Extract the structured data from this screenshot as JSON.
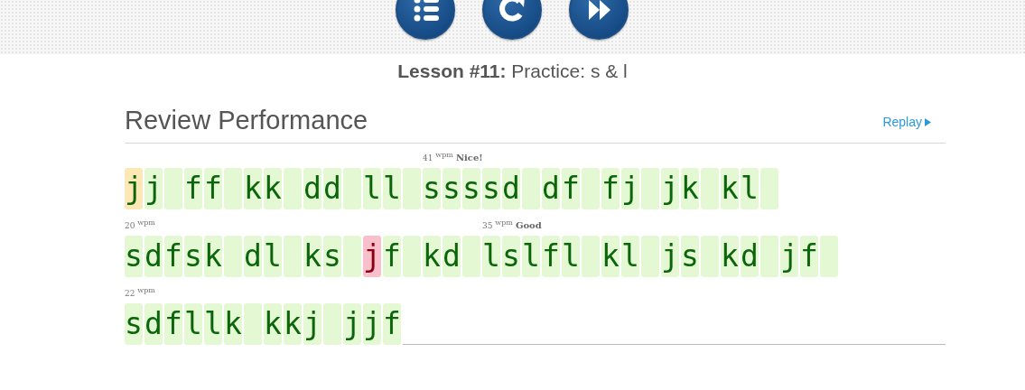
{
  "toolbar": {
    "buttons": [
      {
        "kind": "list"
      },
      {
        "kind": "repeat"
      },
      {
        "kind": "next"
      }
    ]
  },
  "lesson": "**Lesson #11:** Practice: s & l",
  "review": {
    "title": "Review Performance",
    "replay": "Replay"
  },
  "lines": [
    {
      "words": [
        {
          "chars": [
            {
              "char": "j",
              "corrected": true,
              "error": false
            },
            {
              "char": "j",
              "corrected": false,
              "error": false
            }
          ],
          "space_after": true
        },
        {
          "chars": [
            {
              "char": "f",
              "corrected": false,
              "error": false
            },
            {
              "char": "f",
              "corrected": false,
              "error": false
            }
          ],
          "space_after": true
        },
        {
          "chars": [
            {
              "char": "k",
              "corrected": false,
              "error": false
            },
            {
              "char": "k",
              "corrected": false,
              "error": false
            }
          ],
          "space_after": true
        },
        {
          "chars": [
            {
              "char": "d",
              "corrected": false,
              "error": false
            },
            {
              "char": "d",
              "corrected": false,
              "error": false
            }
          ],
          "space_after": true
        },
        {
          "chars": [
            {
              "char": "l",
              "corrected": false,
              "error": false
            },
            {
              "char": "l",
              "corrected": false,
              "error": false
            }
          ],
          "space_after": true
        },
        {
          "speed": {
            "value": "41",
            "unit": "wpm",
            "rating": "Nice!"
          },
          "chars": [
            {
              "char": "s",
              "corrected": false,
              "error": false
            },
            {
              "char": "s",
              "corrected": false,
              "error": false
            },
            {
              "char": "s",
              "corrected": false,
              "error": false
            },
            {
              "char": "s",
              "corrected": false,
              "error": false
            },
            {
              "char": "d",
              "corrected": false,
              "error": false
            }
          ],
          "space_after": true
        },
        {
          "chars": [
            {
              "char": "d",
              "corrected": false,
              "error": false
            },
            {
              "char": "f",
              "corrected": false,
              "error": false
            }
          ],
          "space_after": true
        },
        {
          "chars": [
            {
              "char": "f",
              "corrected": false,
              "error": false
            },
            {
              "char": "j",
              "corrected": false,
              "error": false
            }
          ],
          "space_after": true
        },
        {
          "chars": [
            {
              "char": "j",
              "corrected": false,
              "error": false
            },
            {
              "char": "k",
              "corrected": false,
              "error": false
            }
          ],
          "space_after": true
        },
        {
          "chars": [
            {
              "char": "k",
              "corrected": false,
              "error": false
            },
            {
              "char": "l",
              "corrected": false,
              "error": false
            }
          ],
          "space_after": true
        }
      ]
    },
    {
      "words": [
        {
          "speed": {
            "value": "20",
            "unit": "wpm"
          },
          "chars": [
            {
              "char": "s",
              "corrected": false,
              "error": false
            },
            {
              "char": "d",
              "corrected": false,
              "error": false
            },
            {
              "char": "f",
              "corrected": false,
              "error": false
            },
            {
              "char": "s",
              "corrected": false,
              "error": false
            },
            {
              "char": "k",
              "corrected": false,
              "error": false
            }
          ],
          "space_after": true
        },
        {
          "chars": [
            {
              "char": "d",
              "corrected": false,
              "error": false
            },
            {
              "char": "l",
              "corrected": false,
              "error": false
            }
          ],
          "space_after": true
        },
        {
          "chars": [
            {
              "char": "k",
              "corrected": false,
              "error": false
            },
            {
              "char": "s",
              "corrected": false,
              "error": false
            }
          ],
          "space_after": true
        },
        {
          "chars": [
            {
              "char": "j",
              "corrected": false,
              "error": true
            },
            {
              "char": "f",
              "corrected": false,
              "error": false
            }
          ],
          "space_after": true
        },
        {
          "chars": [
            {
              "char": "k",
              "corrected": false,
              "error": false
            },
            {
              "char": "d",
              "corrected": false,
              "error": false
            }
          ],
          "space_after": true
        },
        {
          "speed": {
            "value": "35",
            "unit": "wpm",
            "rating": "Good"
          },
          "chars": [
            {
              "char": "l",
              "corrected": false,
              "error": false
            },
            {
              "char": "s",
              "corrected": false,
              "error": false
            },
            {
              "char": "l",
              "corrected": false,
              "error": false
            },
            {
              "char": "f",
              "corrected": false,
              "error": false
            },
            {
              "char": "l",
              "corrected": false,
              "error": false
            }
          ],
          "space_after": true
        },
        {
          "chars": [
            {
              "char": "k",
              "corrected": false,
              "error": false
            },
            {
              "char": "l",
              "corrected": false,
              "error": false
            }
          ],
          "space_after": true
        },
        {
          "chars": [
            {
              "char": "j",
              "corrected": false,
              "error": false
            },
            {
              "char": "s",
              "corrected": false,
              "error": false
            }
          ],
          "space_after": true
        },
        {
          "chars": [
            {
              "char": "k",
              "corrected": false,
              "error": false
            },
            {
              "char": "d",
              "corrected": false,
              "error": false
            }
          ],
          "space_after": true
        },
        {
          "chars": [
            {
              "char": "j",
              "corrected": false,
              "error": false
            },
            {
              "char": "f",
              "corrected": false,
              "error": false
            }
          ],
          "space_after": true
        }
      ]
    },
    {
      "words": [
        {
          "speed": {
            "value": "22",
            "unit": "wpm"
          },
          "chars": [
            {
              "char": "s",
              "corrected": false,
              "error": false
            },
            {
              "char": "d",
              "corrected": false,
              "error": false
            },
            {
              "char": "f",
              "corrected": false,
              "error": false
            },
            {
              "char": "l",
              "corrected": false,
              "error": false
            },
            {
              "char": "l",
              "corrected": false,
              "error": false
            },
            {
              "char": "k",
              "corrected": false,
              "error": false
            }
          ],
          "space_after": true
        },
        {
          "chars": [
            {
              "char": "k",
              "corrected": false,
              "error": false
            },
            {
              "char": "k",
              "corrected": false,
              "error": false
            },
            {
              "char": "j",
              "corrected": false,
              "error": false
            }
          ],
          "space_after": true
        },
        {
          "chars": [
            {
              "char": "j",
              "corrected": false,
              "error": false
            },
            {
              "char": "j",
              "corrected": false,
              "error": false
            },
            {
              "char": "f",
              "corrected": false,
              "error": false
            }
          ],
          "space_after": false
        }
      ]
    }
  ]
}
